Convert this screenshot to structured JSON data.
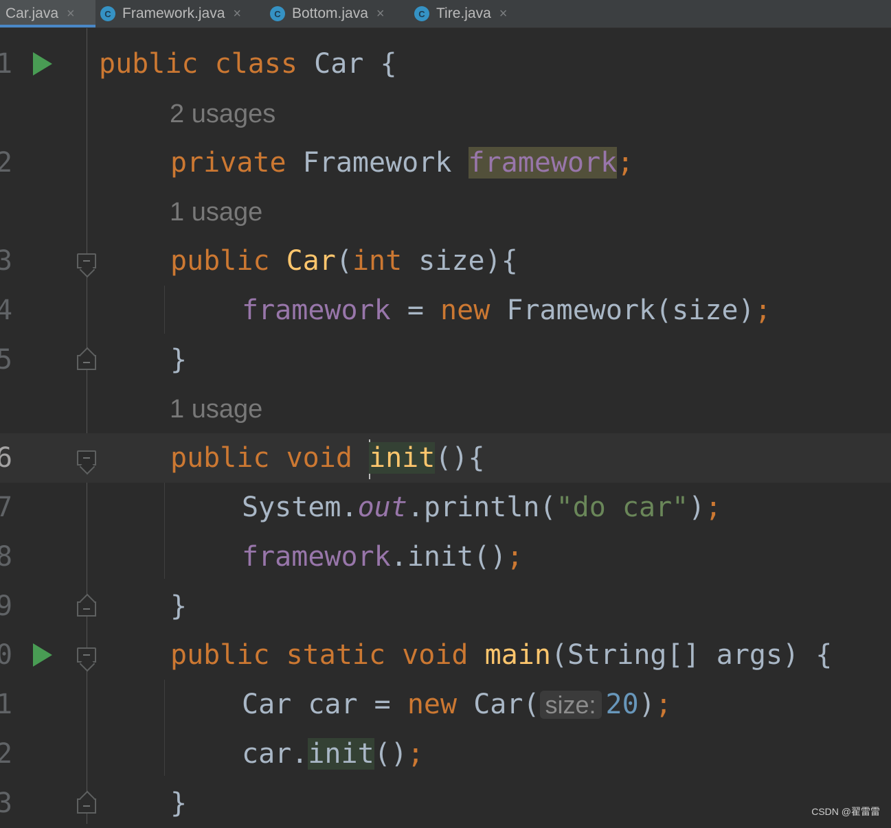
{
  "tabs": [
    {
      "label": "Car.java",
      "icon": "java-class-icon",
      "active": true
    },
    {
      "label": "Framework.java",
      "icon": "java-class-icon",
      "active": false
    },
    {
      "label": "Bottom.java",
      "icon": "java-class-icon",
      "active": false
    },
    {
      "label": "Tire.java",
      "icon": "java-class-icon",
      "active": false
    }
  ],
  "tab_icon_letter": "C",
  "close_glyph": "×",
  "gutter": {
    "line_numbers": [
      "1",
      "2",
      "3",
      "4",
      "5",
      "6",
      "7",
      "8",
      "9",
      "0",
      "1",
      "2",
      "3"
    ],
    "current_line": "6"
  },
  "hints": {
    "field_usages": "2 usages",
    "constructor_usages": "1 usage",
    "init_usages": "1 usage"
  },
  "code": {
    "l1": {
      "kw1": "public",
      "kw2": "class",
      "name": "Car",
      "brace": "{"
    },
    "l2": {
      "kw": "private",
      "type": "Framework",
      "field": "framework",
      "semi": ";"
    },
    "l3": {
      "kw": "public",
      "ctor": "Car",
      "open": "(",
      "ptype": "int",
      "param": "size",
      "close": "){"
    },
    "l4": {
      "field": "framework",
      "eq": "=",
      "kw": "new",
      "call": "Framework(size)",
      "semi": ";"
    },
    "l5": {
      "brace": "}"
    },
    "l6": {
      "kw1": "public",
      "kw2": "void",
      "method": "init",
      "rest": "(){"
    },
    "l7": {
      "obj": "System.",
      "static_field": "out",
      "call": ".println(",
      "str": "\"do car\"",
      "close": ")",
      "semi": ";"
    },
    "l8": {
      "field": "framework",
      "call": ".init()",
      "semi": ";"
    },
    "l9": {
      "brace": "}"
    },
    "l10": {
      "kw1": "public",
      "kw2": "static",
      "kw3": "void",
      "method": "main",
      "params": "(String[] args) {"
    },
    "l11": {
      "decl": "Car car =",
      "kw": "new",
      "call": "Car(",
      "hint": "size:",
      "num": "20",
      "close": ")",
      "semi": ";"
    },
    "l12": {
      "obj": "car.",
      "method": "init",
      "call": "()",
      "semi": ";"
    },
    "l13": {
      "brace": "}"
    }
  },
  "watermark": "CSDN @翟雷雷",
  "colors": {
    "background": "#2b2b2b",
    "keyword": "#cc7832",
    "field": "#9876aa",
    "method": "#ffc66d",
    "string": "#6a8759",
    "number": "#6897bb",
    "run_icon": "#499c54"
  }
}
